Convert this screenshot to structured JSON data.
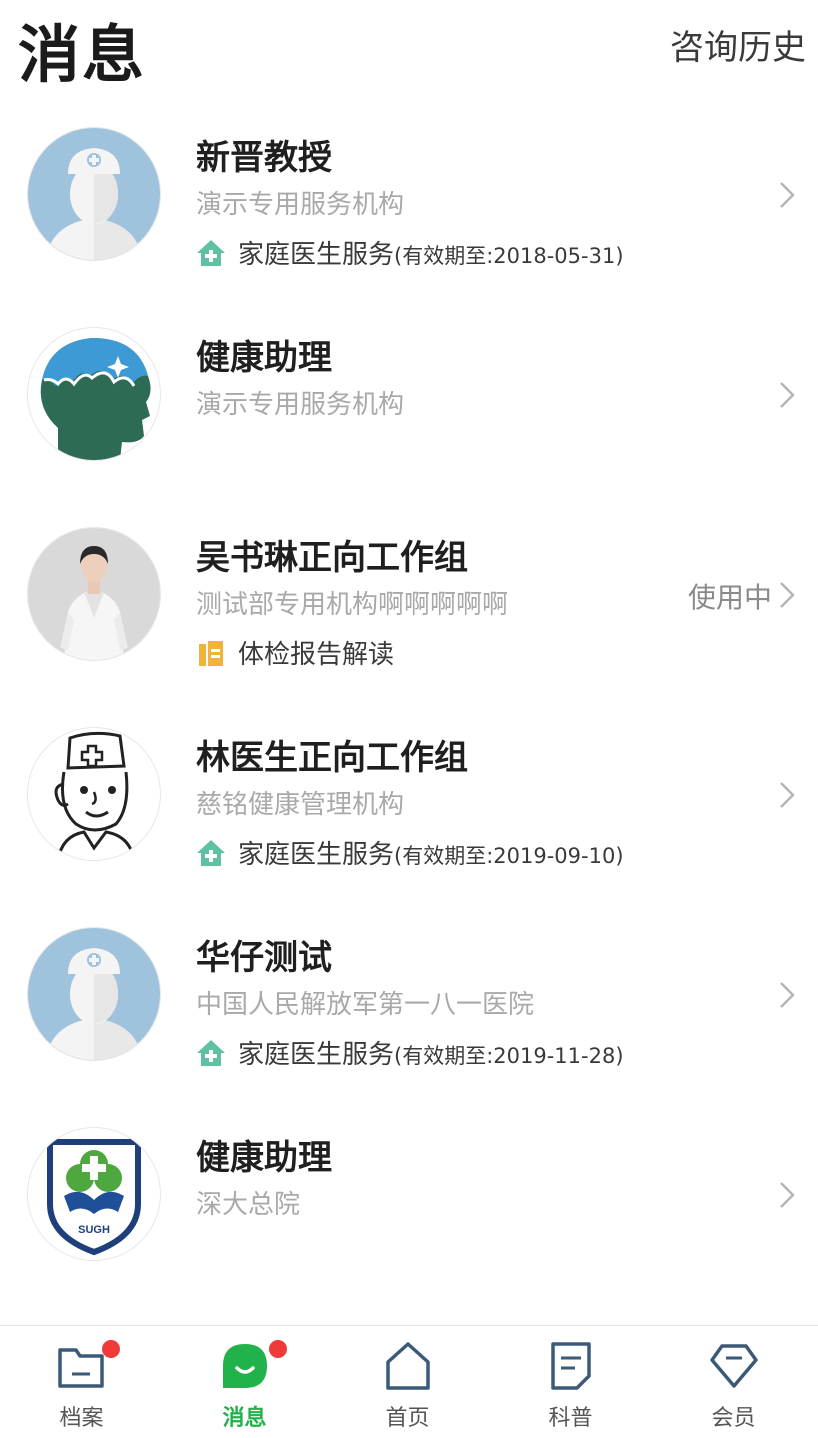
{
  "header": {
    "title": "消息",
    "history_label": "咨询历史"
  },
  "items": [
    {
      "name": "新晋教授",
      "org": "演示专用服务机构",
      "service": {
        "label": "家庭医生服务",
        "validity": "(有效期至:2018-05-31)",
        "icon": "house-plus-icon"
      },
      "avatar": "doctor-avatar"
    },
    {
      "name": "健康助理",
      "org": "演示专用服务机构",
      "avatar": "head-silhouette-avatar"
    },
    {
      "name": "吴书琳正向工作组",
      "org": "测试部专用机构啊啊啊啊啊",
      "status": "使用中",
      "service": {
        "label": "体检报告解读",
        "validity": "",
        "icon": "clipboard-icon"
      },
      "avatar": "photo-avatar"
    },
    {
      "name": "林医生正向工作组",
      "org": "慈铭健康管理机构",
      "service": {
        "label": "家庭医生服务",
        "validity": "(有效期至:2019-09-10)",
        "icon": "house-plus-icon"
      },
      "avatar": "cartoon-doctor-avatar"
    },
    {
      "name": "华仔测试",
      "org": "中国人民解放军第一八一医院",
      "service": {
        "label": "家庭医生服务",
        "validity": "(有效期至:2019-11-28)",
        "icon": "house-plus-icon"
      },
      "avatar": "doctor-avatar"
    },
    {
      "name": "健康助理",
      "org": "深大总院",
      "avatar": "hospital-logo-avatar",
      "logo_text": "SUGH"
    }
  ],
  "tabbar": {
    "tabs": [
      {
        "label": "档案",
        "icon": "folder-icon"
      },
      {
        "label": "消息",
        "icon": "chat-bubble-icon"
      },
      {
        "label": "首页",
        "icon": "home-icon"
      },
      {
        "label": "科普",
        "icon": "article-icon"
      },
      {
        "label": "会员",
        "icon": "gem-icon"
      }
    ],
    "active_index": 1
  },
  "colors": {
    "accent": "#22b24c",
    "badge": "#f03a3a",
    "service_icon": "#5fc0a4",
    "clipboard_icon": "#f0b43c"
  }
}
